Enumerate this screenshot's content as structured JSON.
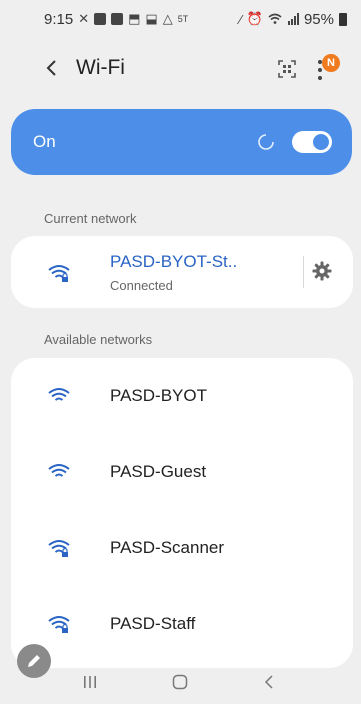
{
  "status_bar": {
    "time": "9:15",
    "signal_label": "5T",
    "battery": "95%"
  },
  "header": {
    "title": "Wi-Fi",
    "notification_badge": "N"
  },
  "wifi_toggle": {
    "label": "On",
    "enabled": true
  },
  "current_section": {
    "label": "Current network"
  },
  "current_network": {
    "name": "PASD-BYOT-St..",
    "status": "Connected"
  },
  "available_section": {
    "label": "Available networks"
  },
  "available_networks": [
    {
      "name": "PASD-BYOT",
      "secured": false
    },
    {
      "name": "PASD-Guest",
      "secured": false
    },
    {
      "name": "PASD-Scanner",
      "secured": true
    },
    {
      "name": "PASD-Staff",
      "secured": true
    }
  ],
  "colors": {
    "accent": "#4d8fe8",
    "connected_text": "#2a64c4",
    "badge": "#f07a1e",
    "background": "#efefef"
  },
  "icons": [
    "back-icon",
    "qr-scan-icon",
    "more-vert-icon",
    "wifi-icon",
    "wifi-lock-icon",
    "gear-icon",
    "pencil-icon",
    "recents-icon",
    "home-icon",
    "nav-back-icon"
  ]
}
